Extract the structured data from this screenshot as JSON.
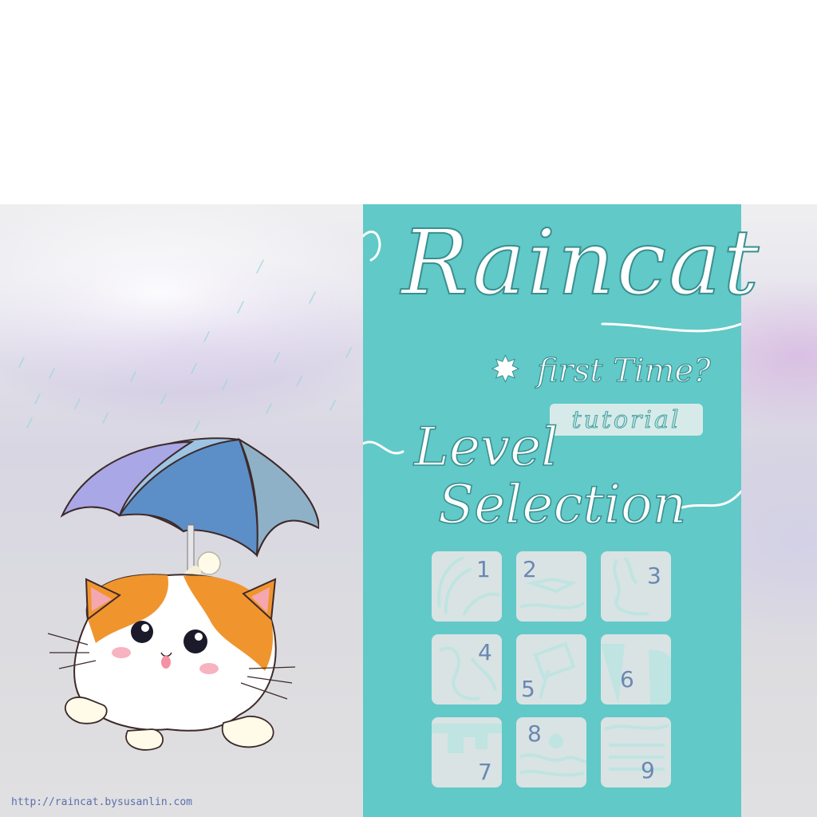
{
  "game": {
    "title": "Raincat",
    "first_time_label": "first Time?",
    "tutorial_label": "tutorial",
    "level_heading_line1": "Level",
    "level_heading_line2": "Selection",
    "url": "http://raincat.bysusanlin.com"
  },
  "levels": [
    {
      "number": "1"
    },
    {
      "number": "2"
    },
    {
      "number": "3"
    },
    {
      "number": "4"
    },
    {
      "number": "5"
    },
    {
      "number": "6"
    },
    {
      "number": "7"
    },
    {
      "number": "8"
    },
    {
      "number": "9"
    }
  ],
  "colors": {
    "panel": "#61c9c8",
    "tile": "#d9e3e3",
    "tile_number": "#6a88b3",
    "umbrella_dark": "#5c8fc8",
    "umbrella_light": "#a9a7e6",
    "cat_orange": "#f0952e"
  },
  "icons": [
    "star-icon",
    "rain-drops",
    "cat-with-umbrella"
  ]
}
